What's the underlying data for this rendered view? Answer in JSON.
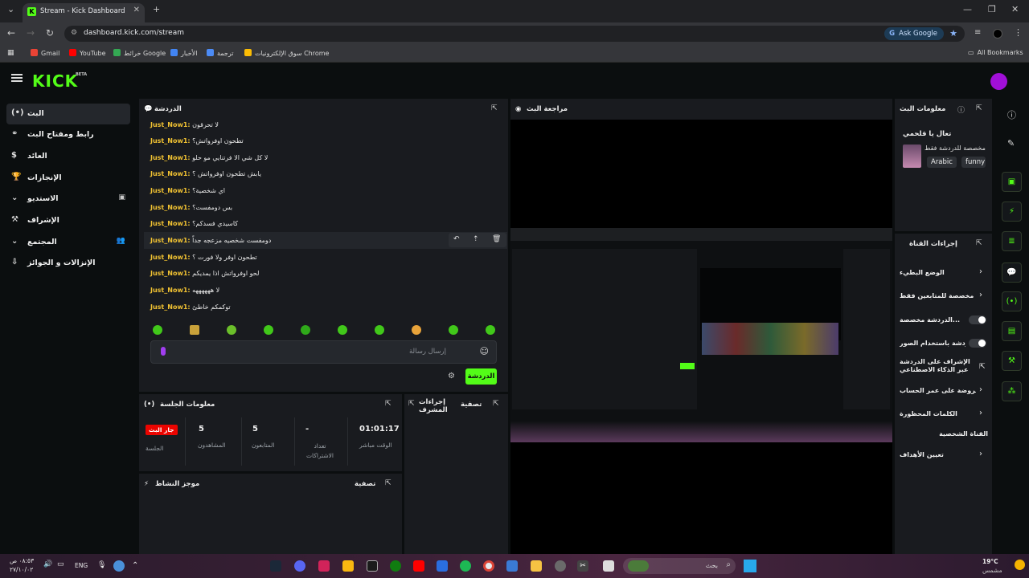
{
  "browser": {
    "tab_title": "Stream - Kick Dashboard",
    "url": "dashboard.kick.com/stream",
    "ask_google": "Ask Google",
    "bookmarks": [
      "Gmail",
      "YouTube",
      "خرائط Google",
      "الأخبار",
      "ترجمة",
      "سوق الإلكترونيات Chrome"
    ],
    "all_bookmarks": "All Bookmarks"
  },
  "brand": {
    "logo": "KICK",
    "beta": "BETA"
  },
  "sidebar": {
    "items": [
      {
        "label": "البث",
        "icon": "(•)"
      },
      {
        "label": "رابط ومفتاح البث",
        "icon": "⚭"
      },
      {
        "label": "العائد",
        "icon": "$"
      },
      {
        "label": "الإنجازات",
        "icon": "🏆"
      },
      {
        "label": "الاستديو",
        "icon": "⌄"
      },
      {
        "label": "الإشراف",
        "icon": "⚒"
      },
      {
        "label": "المجتمع",
        "icon": "⌄"
      },
      {
        "label": "الإنزالات و الجوائز",
        "icon": "⇩"
      }
    ]
  },
  "chat": {
    "title": "الدردشة",
    "username": "Just_Now1:",
    "messages": [
      "لا تحرقون",
      "تطحون اوفرواتش؟",
      "لا كل شي الا فرتنايي مو حلو",
      "يابش تطحون اوفرواتش ؟",
      "اي شخصية؟",
      "بس دومفست؟",
      "كاسيدي فسدكم؟",
      "دومفست شخصيه مزعجه جداً",
      "تطحون اوفر ولا فورت ؟",
      "لحو اوفرواتش اذا يمديكم",
      "لا ههههههه",
      "توكمكم خاطئ"
    ],
    "input_placeholder": "إرسال رسالة",
    "send_button": "الدردشة"
  },
  "preview": {
    "title": "مراجعة البث"
  },
  "session": {
    "title": "معلومات الجلسة",
    "live_badge": "جار البث",
    "session_label": "الجلسة",
    "viewers_value": "5",
    "viewers_label": "المشاهدون",
    "followers_value": "5",
    "followers_label": "المتابعون",
    "subs_value": "-",
    "subs_label": "تعداد الاشتراكات",
    "uptime_value": "01:01:17",
    "uptime_label": "الوقت مباشر"
  },
  "mod_actions": {
    "title": "إجراءات المشرف",
    "filter": "تصفية"
  },
  "activity": {
    "title": "موجز النشاط",
    "filter": "تصفية"
  },
  "stream_info": {
    "title": "معلومات البث",
    "stream_title": "تعال يا قلحمي",
    "category": "مخصصة للدردشة فقط",
    "tags": [
      "Arabic",
      "funny"
    ]
  },
  "channel_actions": {
    "title": "إجراءات القناة",
    "items": [
      {
        "label": "الوضع البطيء",
        "control": "chevron"
      },
      {
        "label": "دردشة مخصصة للمتابعين فقط",
        "control": "chevron"
      },
      {
        "label": "الدردشة مخصصة...",
        "control": "toggle"
      },
      {
        "label": "الدردشة باستخدام الصور",
        "control": "toggle"
      },
      {
        "label": "الإشراف على الدردشة عبر الذكاء الاصطناعي",
        "control": "link"
      },
      {
        "label": "المفروضة على عمر الحساب",
        "control": "chevron"
      },
      {
        "label": "الكلمات المحظورة",
        "control": "chevron"
      },
      {
        "label": "القناة الشخصية",
        "control": "none"
      },
      {
        "label": "تعيين الأهداف",
        "control": "chevron"
      }
    ]
  },
  "taskbar": {
    "search": "بحث",
    "lang": "ENG",
    "time": "٠٨:٥٣ ص",
    "date": "٢٧/١٠/٠٢",
    "weather_temp": "19°C",
    "weather_desc": "مشمس"
  },
  "colors": {
    "accent": "#53fc18",
    "live": "#eb0400",
    "username": "#f1c232",
    "panel": "#191b1f"
  }
}
